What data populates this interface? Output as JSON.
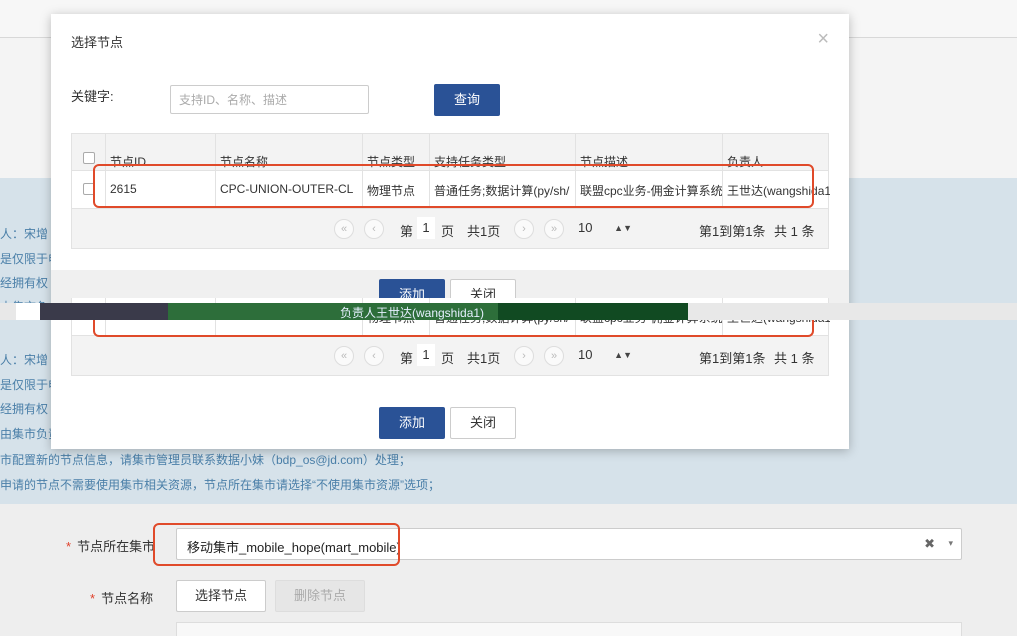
{
  "background": {
    "notice_lines": [
      "人：宋增",
      "是仅限于申",
      "经拥有权",
      "由集市负",
      "人：宋增",
      "是仅限于申",
      "经拥有权",
      "由集市负责",
      "市配置新的节点信息，请集市管理员联系数据小妹（bdp_os@jd.com）处理；",
      "申请的节点不需要使用集市相关资源，节点所在集市请选择“不使用集市资源”选项；"
    ],
    "form": {
      "mart_label": "节点所在集市",
      "mart_value": "移动集市_mobile_hope(mart_mobile)",
      "clear_icon": "✖",
      "arrow_icon": "▾",
      "node_name_label": "节点名称",
      "select_node_button": "选择节点",
      "delete_node_button": "删除节点",
      "required_mark": "*"
    }
  },
  "modal": {
    "title": "选择节点",
    "close_icon": "×",
    "keyword_label": "关键字:",
    "keyword_placeholder": "支持ID、名称、描述",
    "search_button": "查询",
    "columns": [
      "节点ID",
      "节点名称",
      "节点类型",
      "支持任务类型",
      "节点描述",
      "负责人"
    ],
    "rows": [
      {
        "id": "2615",
        "name": "CPC-UNION-OUTER-CL",
        "type": "物理节点",
        "task_types": "普通任务;数据计算(py/sh/",
        "description": "联盟cpc业务-佣金计算系统",
        "owner": "王世达(wangshida1"
      }
    ],
    "pager": {
      "first_icon": "«",
      "prev_icon": "‹",
      "next_icon": "›",
      "last_icon": "»",
      "page_prefix": "第",
      "page_value": "1",
      "page_suffix": "页",
      "total_pages": "共1页",
      "page_size": "10",
      "spin_icon": "▲▼",
      "range_text": "第1到第1条",
      "total_text": "共 1 条"
    },
    "add_button": "添加",
    "close_button": "关闭"
  },
  "glitch": {
    "text": "负责人王世达(wangshida1)"
  }
}
